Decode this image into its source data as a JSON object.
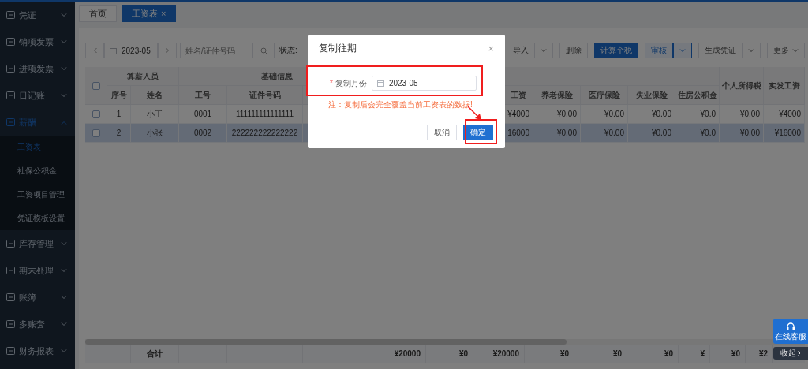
{
  "sidebar": {
    "items": [
      {
        "label": "凭证",
        "selected": false,
        "expanded": false
      },
      {
        "label": "销项发票",
        "selected": false,
        "expanded": false
      },
      {
        "label": "进项发票",
        "selected": false,
        "expanded": false
      },
      {
        "label": "日记账",
        "selected": false,
        "expanded": false
      },
      {
        "label": "薪酬",
        "selected": true,
        "expanded": true,
        "children": [
          {
            "label": "工资表",
            "selected": true
          },
          {
            "label": "社保公积金",
            "selected": false
          },
          {
            "label": "工资项目管理",
            "selected": false
          },
          {
            "label": "凭证模板设置",
            "selected": false
          }
        ]
      },
      {
        "label": "库存管理",
        "selected": false,
        "expanded": false
      },
      {
        "label": "期末处理",
        "selected": false,
        "expanded": false
      },
      {
        "label": "账簿",
        "selected": false,
        "expanded": false
      },
      {
        "label": "多账套",
        "selected": false,
        "expanded": false
      },
      {
        "label": "财务报表",
        "selected": false,
        "expanded": false
      }
    ]
  },
  "tabs": [
    {
      "label": "首页",
      "selected": false
    },
    {
      "label": "工资表",
      "selected": true,
      "close": "×"
    }
  ],
  "toolbar": {
    "period": "2023-05",
    "search": {
      "placeholder": "姓名/证件号码"
    },
    "status": "状态:",
    "buttons": [
      {
        "label": "导入",
        "kind": "split"
      },
      {
        "label": "删除",
        "kind": "plain"
      },
      {
        "label": "计算个税",
        "kind": "primary"
      },
      {
        "label": "审核",
        "kind": "split-outline"
      },
      {
        "label": "生成凭证",
        "kind": "split"
      },
      {
        "label": "更多",
        "kind": "dropdown"
      }
    ]
  },
  "table": {
    "header": [
      {
        "kind": "checkbox",
        "checked": false
      },
      {
        "kind": "group",
        "label": "算薪人员",
        "columns": [
          {
            "label": "序号"
          },
          {
            "label": "姓名"
          }
        ]
      },
      {
        "kind": "group",
        "label": "基础信息",
        "columns": [
          {
            "label": "工号"
          },
          {
            "label": "证件号码"
          },
          {
            "label": "工资"
          }
        ]
      },
      {
        "kind": "group",
        "columns": [
          {
            "label": "养老保险"
          },
          {
            "label": "医疗保险"
          },
          {
            "label": "失业保险"
          },
          {
            "label": "住房公积金"
          }
        ]
      },
      {
        "kind": "column",
        "label": "个人所得税"
      },
      {
        "kind": "column",
        "label": "实发工资"
      }
    ],
    "rows": [
      {
        "selected": false,
        "checked": false,
        "cells": [
          "1",
          "小王",
          "0001",
          "111111111111111",
          "¥4000",
          "¥0.00",
          "¥0.00",
          "¥0.00",
          "¥0.0",
          "¥0.00",
          "¥4000"
        ]
      },
      {
        "selected": true,
        "checked": false,
        "cells": [
          "2",
          "小张",
          "0002",
          "222222222222222",
          "16000",
          "¥0.00",
          "¥0.00",
          "¥0.00",
          "¥0.0",
          "¥0.00",
          "¥16000"
        ]
      }
    ],
    "footer": {
      "label": "合计",
      "values": [
        "¥20000",
        "¥0",
        "¥20000",
        "¥0",
        "¥0",
        "¥0",
        "¥",
        "¥0",
        "¥2"
      ]
    }
  },
  "dialog": {
    "title": "复制往期",
    "close": "×",
    "field": {
      "required_mark": "*",
      "label": "复制月份",
      "value": "2023-05"
    },
    "warning": "注：复制后会完全覆盖当前工资表的数据!",
    "buttons": [
      {
        "label": "取消",
        "kind": "default"
      },
      {
        "label": "确定",
        "kind": "primary"
      }
    ]
  },
  "service": {
    "label": "在线客服",
    "collapse": "收起"
  }
}
